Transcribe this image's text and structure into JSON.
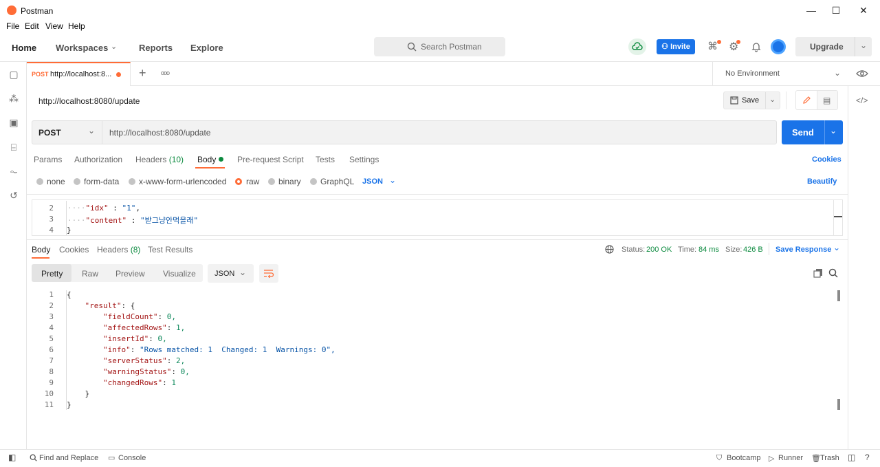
{
  "window": {
    "title": "Postman",
    "minimize": "—",
    "maximize": "☐",
    "close": "✕"
  },
  "menu": [
    "File",
    "Edit",
    "View",
    "Help"
  ],
  "header": {
    "nav": {
      "home": "Home",
      "workspaces": "Workspaces",
      "reports": "Reports",
      "explore": "Explore"
    },
    "search_placeholder": "Search Postman",
    "invite": "Invite",
    "upgrade": "Upgrade"
  },
  "tab": {
    "method": "POST",
    "title": "http://localhost:8...",
    "add": "+",
    "more": "ooo"
  },
  "environment": {
    "label": "No Environment"
  },
  "request": {
    "title": "http://localhost:8080/update",
    "save": "Save",
    "method": "POST",
    "url": "http://localhost:8080/update",
    "send": "Send",
    "tabs": {
      "params": "Params",
      "authorization": "Authorization",
      "headers": "Headers",
      "headers_count": "(10)",
      "body": "Body",
      "prerequest": "Pre-request Script",
      "tests": "Tests",
      "settings": "Settings"
    },
    "cookies": "Cookies",
    "body_types": {
      "none": "none",
      "form_data": "form-data",
      "urlencoded": "x-www-form-urlencoded",
      "raw": "raw",
      "binary": "binary",
      "graphql": "GraphQL"
    },
    "body_format": "JSON",
    "beautify": "Beautify",
    "editor": {
      "lines": [
        {
          "n": "2",
          "key": "\"idx\"",
          "sep": " : ",
          "val": "\"1\"",
          "end": ","
        },
        {
          "n": "3",
          "key": "\"content\"",
          "sep": " : ",
          "val": "\"받그냥안먹을래\"",
          "end": ""
        },
        {
          "n": "4",
          "key": "",
          "sep": "",
          "val": "",
          "end": "}"
        }
      ]
    }
  },
  "response": {
    "tabs": {
      "body": "Body",
      "cookies": "Cookies",
      "headers": "Headers",
      "headers_count": "(8)",
      "test_results": "Test Results"
    },
    "status_label": "Status:",
    "status_value": "200 OK",
    "time_label": "Time:",
    "time_value": "84 ms",
    "size_label": "Size:",
    "size_value": "426 B",
    "save_response": "Save Response",
    "views": {
      "pretty": "Pretty",
      "raw": "Raw",
      "preview": "Preview",
      "visualize": "Visualize"
    },
    "format": "JSON",
    "lines": [
      {
        "n": "1",
        "text": "{"
      },
      {
        "n": "2",
        "text": "    \"result\": {"
      },
      {
        "n": "3",
        "text": "        \"fieldCount\": 0,"
      },
      {
        "n": "4",
        "text": "        \"affectedRows\": 1,"
      },
      {
        "n": "5",
        "text": "        \"insertId\": 0,"
      },
      {
        "n": "6",
        "text": "        \"info\": \"Rows matched: 1  Changed: 1  Warnings: 0\","
      },
      {
        "n": "7",
        "text": "        \"serverStatus\": 2,"
      },
      {
        "n": "8",
        "text": "        \"warningStatus\": 0,"
      },
      {
        "n": "9",
        "text": "        \"changedRows\": 1"
      },
      {
        "n": "10",
        "text": "    }"
      },
      {
        "n": "11",
        "text": "}"
      }
    ]
  },
  "footer": {
    "find_replace": "Find and Replace",
    "console": "Console",
    "bootcamp": "Bootcamp",
    "runner": "Runner",
    "trash": "Trash"
  },
  "colors": {
    "accent": "#ff6c37",
    "primary": "#1a73e8",
    "success": "#0b8a3e"
  }
}
